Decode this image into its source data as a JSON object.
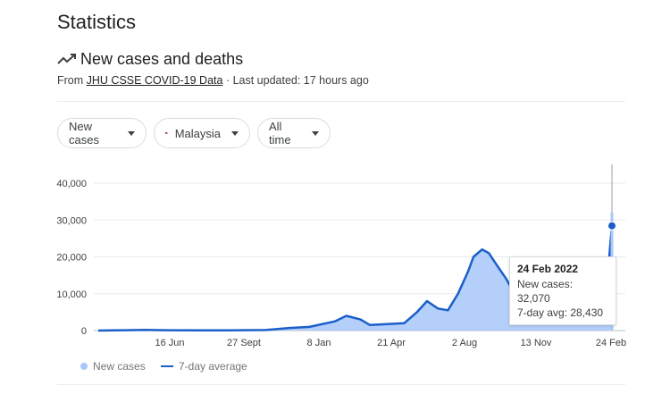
{
  "page": {
    "title": "Statistics"
  },
  "section": {
    "title": "New cases and deaths",
    "trend_icon": "trending-up-icon",
    "source_prefix": "From ",
    "source_link": "JHU CSSE COVID-19 Data",
    "updated_text": " · Last updated: 17 hours ago"
  },
  "filters": {
    "metric": "New cases",
    "country": "Malaysia",
    "country_icon": "malaysia-flag-icon",
    "range": "All time"
  },
  "tooltip": {
    "date": "24 Feb 2022",
    "new_cases": "New cases: 32,070",
    "avg": "7-day avg: 28,430"
  },
  "legend": {
    "bars": "New cases",
    "line": "7-day average"
  },
  "colors": {
    "line": "#1a5fc9",
    "area": "#a8c7fa",
    "grid": "#e8eaed"
  },
  "chart_data": {
    "type": "area",
    "title": "",
    "xlabel": "",
    "ylabel": "",
    "ylim": [
      0,
      40000
    ],
    "y_ticks": [
      "40,000",
      "30,000",
      "20,000",
      "10,000",
      "0"
    ],
    "y_tick_values": [
      40000,
      30000,
      20000,
      10000,
      0
    ],
    "x_ticks": [
      "16 Jun",
      "27 Sept",
      "8 Jan",
      "21 Apr",
      "2 Aug",
      "13 Nov",
      "24 Feb"
    ],
    "grid": true,
    "legend_position": "bottom-left",
    "series": [
      {
        "name": "7-day average",
        "x": [
          "22 Jan 2020",
          "1 Mar 2020",
          "1 Apr 2020",
          "1 May 2020",
          "16 Jun 2020",
          "1 Aug 2020",
          "27 Sept 2020",
          "15 Oct 2020",
          "1 Nov 2020",
          "1 Dec 2020",
          "8 Jan 2021",
          "25 Jan 2021",
          "15 Feb 2021",
          "1 Mar 2021",
          "21 Apr 2021",
          "10 May 2021",
          "25 May 2021",
          "10 Jun 2021",
          "25 Jun 2021",
          "10 Jul 2021",
          "25 Jul 2021",
          "2 Aug 2021",
          "15 Aug 2021",
          "25 Aug 2021",
          "5 Sep 2021",
          "20 Sep 2021",
          "5 Oct 2021",
          "20 Oct 2021",
          "13 Nov 2021",
          "1 Dec 2021",
          "20 Dec 2021",
          "5 Jan 2022",
          "25 Jan 2022",
          "5 Feb 2022",
          "15 Feb 2022",
          "20 Feb 2022",
          "24 Feb 2022"
        ],
        "values": [
          0,
          100,
          200,
          100,
          50,
          50,
          150,
          400,
          700,
          1000,
          2500,
          4000,
          3000,
          1500,
          2000,
          5000,
          8000,
          6000,
          5500,
          10000,
          16000,
          20000,
          22000,
          21000,
          18000,
          14000,
          9000,
          6000,
          5500,
          5000,
          4000,
          3500,
          3000,
          4000,
          8000,
          20000,
          28430
        ]
      }
    ],
    "highlight": {
      "x": "24 Feb 2022",
      "new_cases": 32070,
      "avg_7day": 28430
    }
  }
}
